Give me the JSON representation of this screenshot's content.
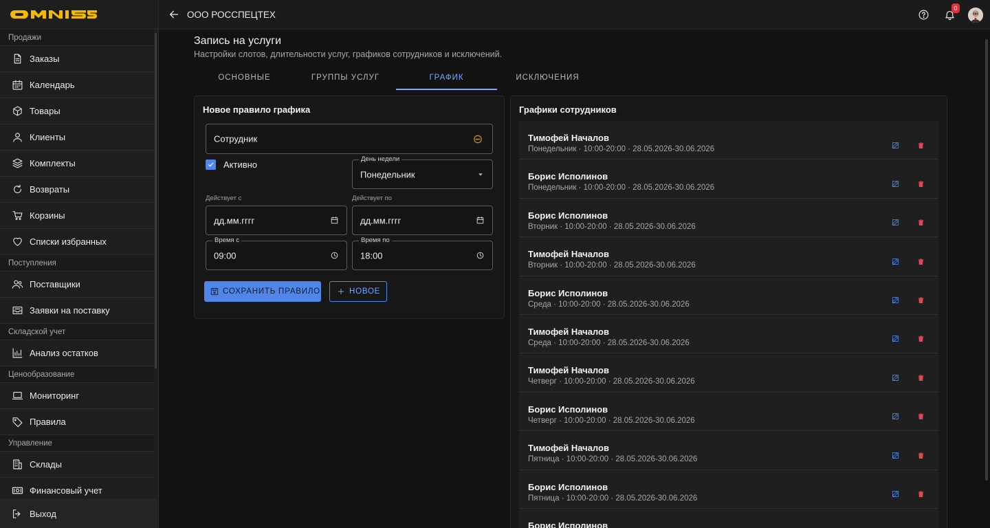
{
  "brand": {
    "logo_text": "OMNIS",
    "accent": "#f5b800"
  },
  "header": {
    "company": "ООО РОССПЕЦТЕХ",
    "notifications_count": "0"
  },
  "sidebar": {
    "sections": [
      {
        "title": "Продажи",
        "items": [
          {
            "label": "Заказы",
            "icon": "document-icon"
          },
          {
            "label": "Календарь",
            "icon": "calendar-icon"
          },
          {
            "label": "Товары",
            "icon": "box-icon"
          },
          {
            "label": "Клиенты",
            "icon": "user-icon"
          },
          {
            "label": "Комплекты",
            "icon": "layers-icon"
          },
          {
            "label": "Возвраты",
            "icon": "refresh-icon"
          },
          {
            "label": "Корзины",
            "icon": "cart-icon"
          },
          {
            "label": "Списки избранных",
            "icon": "heart-icon"
          }
        ]
      },
      {
        "title": "Поступления",
        "items": [
          {
            "label": "Поставщики",
            "icon": "users-icon"
          },
          {
            "label": "Заявки на поставку",
            "icon": "inbox-icon"
          }
        ]
      },
      {
        "title": "Складской учет",
        "items": [
          {
            "label": "Анализ остатков",
            "icon": "bar-chart-icon"
          }
        ]
      },
      {
        "title": "Ценообразование",
        "items": [
          {
            "label": "Мониторинг",
            "icon": "laptop-icon"
          },
          {
            "label": "Правила",
            "icon": "tag-icon"
          }
        ]
      },
      {
        "title": "Управление",
        "items": [
          {
            "label": "Склады",
            "icon": "building-icon"
          },
          {
            "label": "Финансовый учет",
            "icon": "money-icon"
          }
        ]
      }
    ],
    "logout": "Выход"
  },
  "page": {
    "title": "Запись на услуги",
    "subtitle": "Настройки слотов, длительности услуг, графиков сотрудников и исключений.",
    "tabs": [
      {
        "label": "ОСНОВНЫЕ",
        "active": false
      },
      {
        "label": "ГРУППЫ УСЛУГ",
        "active": false
      },
      {
        "label": "ГРАФИК",
        "active": true
      },
      {
        "label": "ИСКЛЮЧЕНИЯ",
        "active": false
      }
    ]
  },
  "rule_form": {
    "title": "Новое правило графика",
    "employee_placeholder": "Сотрудник",
    "active_label": "Активно",
    "active_checked": true,
    "weekday_label": "День недели",
    "weekday_value": "Понедельник",
    "valid_from_label": "Действует с",
    "valid_from_value": "дд.мм.гггг",
    "valid_to_label": "Действует по",
    "valid_to_value": "дд.мм.гггг",
    "time_from_label": "Время с",
    "time_from_value": "09:00",
    "time_to_label": "Время по",
    "time_to_value": "18:00",
    "save_button": "СОХРАНИТЬ ПРАВИЛО",
    "new_button": "НОВОЕ"
  },
  "schedules": {
    "title": "Графики сотрудников",
    "rows": [
      {
        "name": "Тимофей Началов",
        "meta": "Понедельник · 10:00-20:00 · 28.05.2026-30.06.2026"
      },
      {
        "name": "Борис Исполинов",
        "meta": "Понедельник · 10:00-20:00 · 28.05.2026-30.06.2026"
      },
      {
        "name": "Борис Исполинов",
        "meta": "Вторник · 10:00-20:00 · 28.05.2026-30.06.2026"
      },
      {
        "name": "Тимофей Началов",
        "meta": "Вторник · 10:00-20:00 · 28.05.2026-30.06.2026"
      },
      {
        "name": "Борис Исполинов",
        "meta": "Среда · 10:00-20:00 · 28.05.2026-30.06.2026"
      },
      {
        "name": "Тимофей Началов",
        "meta": "Среда · 10:00-20:00 · 28.05.2026-30.06.2026"
      },
      {
        "name": "Тимофей Началов",
        "meta": "Четверг · 10:00-20:00 · 28.05.2026-30.06.2026"
      },
      {
        "name": "Борис Исполинов",
        "meta": "Четверг · 10:00-20:00 · 28.05.2026-30.06.2026"
      },
      {
        "name": "Тимофей Началов",
        "meta": "Пятница · 10:00-20:00 · 28.05.2026-30.06.2026"
      },
      {
        "name": "Борис Исполинов",
        "meta": "Пятница · 10:00-20:00 · 28.05.2026-30.06.2026"
      },
      {
        "name": "Борис Исполинов",
        "meta": ""
      }
    ]
  }
}
